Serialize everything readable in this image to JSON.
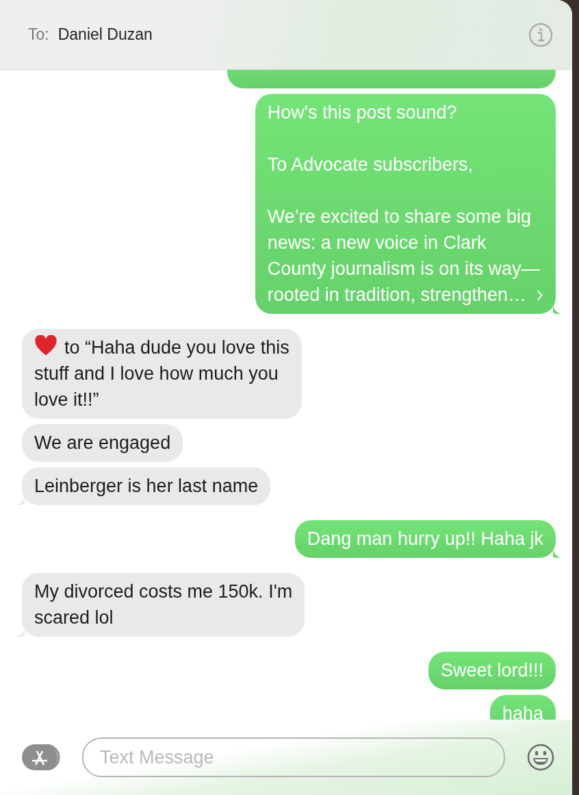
{
  "header": {
    "to_label": "To:",
    "recipient": "Daniel Duzan"
  },
  "messages": [
    {
      "kind": "sent",
      "tail": false,
      "expandable": false,
      "reaction": false
    },
    {
      "kind": "sent",
      "text": "How's this post sound?\n\nTo Advocate subscribers,\n\nWe’re excited to share some big\nnews: a new voice in Clark\nCounty journalism is on its way—\nrooted in tradition, strengthen…",
      "tail": true,
      "expandable": true,
      "reaction": false
    },
    {
      "kind": "received",
      "text": "to “Haha dude you love this\nstuff and I love how much you\nlove it!!”",
      "tail": false,
      "expandable": false,
      "reaction": true
    },
    {
      "kind": "received",
      "text": "We are engaged",
      "tail": false,
      "expandable": false,
      "reaction": false
    },
    {
      "kind": "received",
      "text": "Leinberger is her last name",
      "tail": true,
      "expandable": false,
      "reaction": false
    },
    {
      "kind": "sent",
      "text": "Dang man hurry up!! Haha jk",
      "tail": true,
      "expandable": false,
      "reaction": false
    },
    {
      "kind": "received",
      "text": "My divorced costs me 150k.  I'm\nscared lol",
      "tail": true,
      "expandable": false,
      "reaction": false
    },
    {
      "kind": "sent",
      "text": "Sweet lord!!!",
      "tail": false,
      "expandable": false,
      "reaction": false
    },
    {
      "kind": "sent",
      "text": "haha",
      "expandable": false,
      "reaction": false
    }
  ],
  "composer": {
    "placeholder": "Text Message"
  }
}
